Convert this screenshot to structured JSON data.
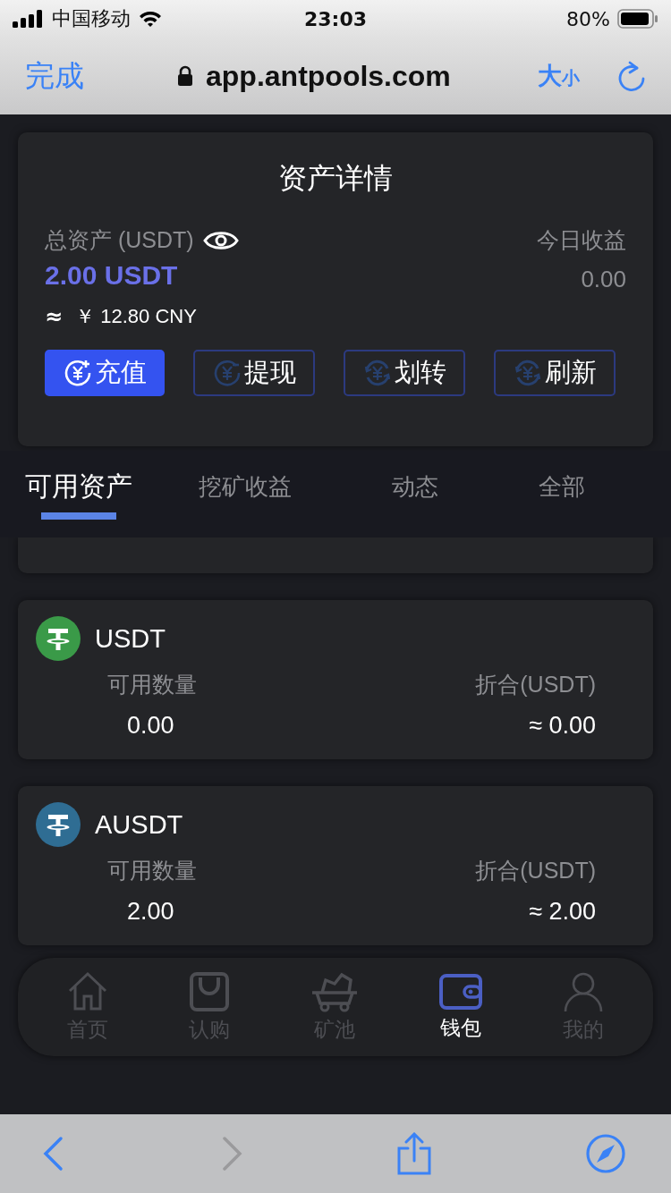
{
  "status_bar": {
    "carrier": "中国移动",
    "time": "23:03",
    "battery": "80%"
  },
  "browser": {
    "done": "完成",
    "url": "app.antpools.com",
    "text_size_big": "大",
    "text_size_small": "小"
  },
  "asset_card": {
    "title": "资产详情",
    "total_label": "总资产 (USDT)",
    "total_value": "2.00 USDT",
    "cny_approx": "≈",
    "cny_value": "￥ 12.80 CNY",
    "today_label": "今日收益",
    "today_value": "0.00",
    "actions": [
      {
        "label": "充值",
        "kind": "deposit",
        "selected": true
      },
      {
        "label": "提现",
        "kind": "withdraw",
        "selected": false
      },
      {
        "label": "划转",
        "kind": "transfer",
        "selected": false
      },
      {
        "label": "刷新",
        "kind": "refresh",
        "selected": false
      }
    ]
  },
  "tabs": [
    {
      "label": "可用资产",
      "selected": true
    },
    {
      "label": "挖矿收益",
      "selected": false
    },
    {
      "label": "动态",
      "selected": false
    },
    {
      "label": "全部",
      "selected": false
    }
  ],
  "partial_card": {
    "kind": "card"
  },
  "coins": [
    {
      "name": "USDT",
      "color": "#3a9a48",
      "amount_label": "可用数量",
      "amount": "0.00",
      "converted_label": "折合(USDT)",
      "converted": "≈ 0.00"
    },
    {
      "name": "AUSDT",
      "color": "#2f6d93",
      "amount_label": "可用数量",
      "amount": "2.00",
      "converted_label": "折合(USDT)",
      "converted": "≈ 2.00"
    }
  ],
  "nav": [
    {
      "label": "首页",
      "kind": "home",
      "selected": false
    },
    {
      "label": "认购",
      "kind": "bag",
      "selected": false
    },
    {
      "label": "矿池",
      "kind": "cart",
      "selected": false
    },
    {
      "label": "钱包",
      "kind": "wallet",
      "selected": true
    },
    {
      "label": "我的",
      "kind": "user",
      "selected": false
    }
  ]
}
